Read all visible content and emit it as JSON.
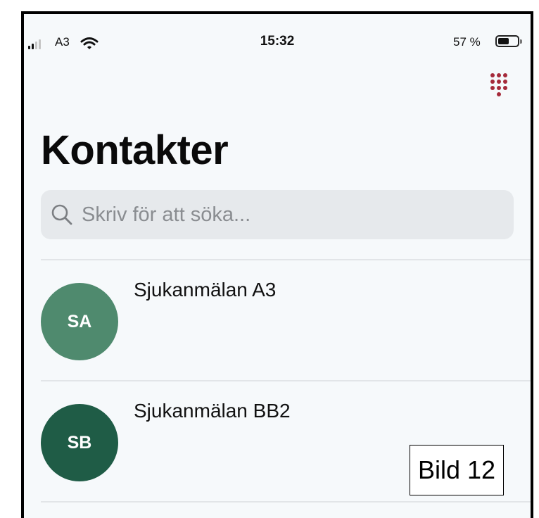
{
  "status_bar": {
    "carrier": "A3",
    "time": "15:32",
    "battery_percent": "57 %",
    "battery_level": 0.57,
    "signal_bars": 2
  },
  "header": {
    "keypad_icon": "dialpad-icon",
    "keypad_color": "#a52a3a",
    "title": "Kontakter"
  },
  "search": {
    "placeholder": "Skriv för att söka...",
    "value": ""
  },
  "contacts": [
    {
      "initials": "SA",
      "name": "Sjukanmälan A3",
      "color": "#4f8a6e"
    },
    {
      "initials": "SB",
      "name": "Sjukanmälan BB2",
      "color": "#1f5c46"
    }
  ],
  "caption": "Bild 12"
}
